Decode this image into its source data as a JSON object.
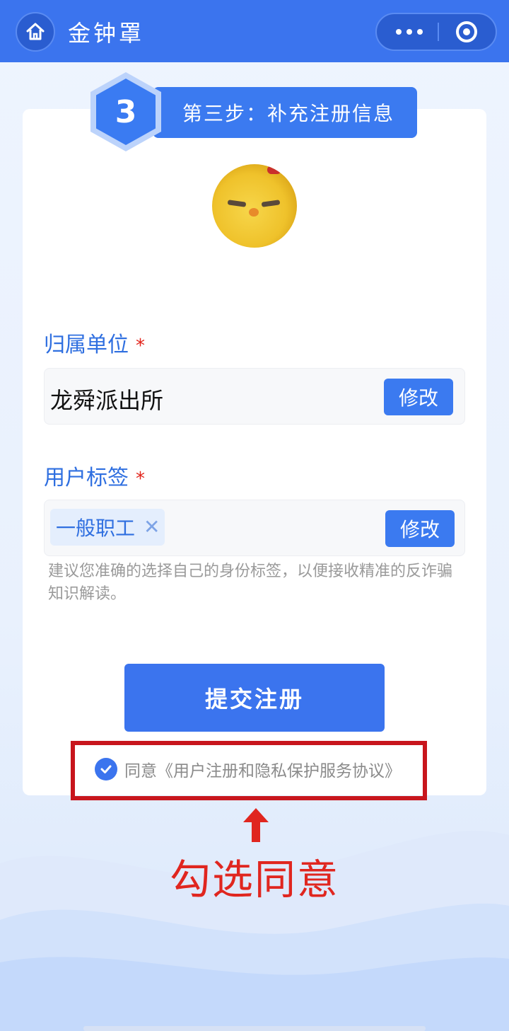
{
  "header": {
    "title": "金钟罩",
    "home_icon": "home-icon",
    "more_icon": "more-dots-icon",
    "close_icon": "target-close-icon"
  },
  "step": {
    "number": "3",
    "label": "第三步：补充注册信息"
  },
  "form": {
    "unit": {
      "label": "归属单位",
      "required_mark": "*",
      "value": "龙舜派出所",
      "edit_label": "修改"
    },
    "tags": {
      "label": "用户标签",
      "required_mark": "*",
      "selected": [
        "一般职工"
      ],
      "remove_glyph": "✕",
      "edit_label": "修改",
      "hint": "建议您准确的选择自己的身份标签，以便接收精准的反诈骗知识解读。"
    }
  },
  "submit": {
    "label": "提交注册"
  },
  "agreement": {
    "checked": true,
    "text": "同意《用户注册和隐私保护服务协议》"
  },
  "annotation": {
    "text": "勾选同意",
    "color": "#e0261f"
  },
  "colors": {
    "primary": "#3b74ee",
    "label_blue": "#2f6fe0",
    "required_red": "#e2231a"
  }
}
